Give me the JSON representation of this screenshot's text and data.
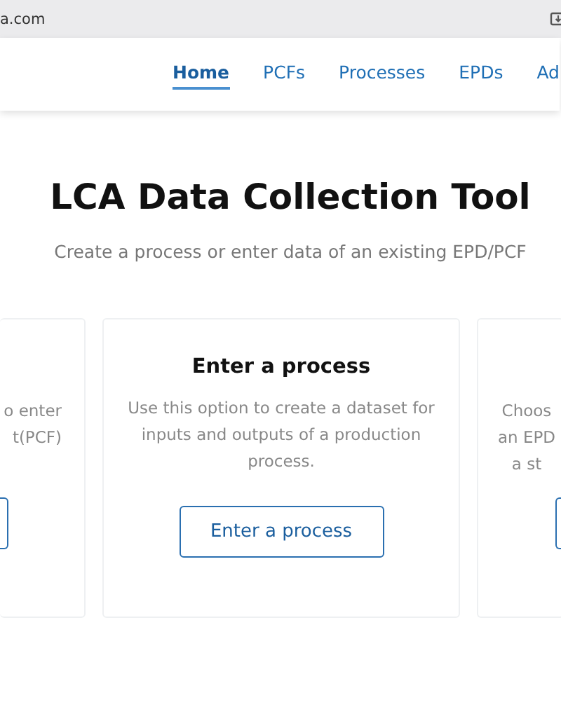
{
  "browser": {
    "url": "a.com"
  },
  "nav": {
    "items": [
      {
        "label": "Home",
        "selected": true
      },
      {
        "label": "PCFs",
        "selected": false
      },
      {
        "label": "Processes",
        "selected": false
      },
      {
        "label": "EPDs",
        "selected": false
      },
      {
        "label": "Ad",
        "selected": false
      }
    ]
  },
  "hero": {
    "title": "LCA Data Collection Tool",
    "subtitle": "Create a process or enter data of an existing EPD/PCF"
  },
  "cards": [
    {
      "kind": "clipped-left",
      "lines": [
        "o enter",
        "t(PCF)"
      ]
    },
    {
      "kind": "full",
      "heading": "Enter a process",
      "description": "Use this option to create a dataset for inputs and outputs of a production process.",
      "button": "Enter a process"
    },
    {
      "kind": "clipped-right",
      "lines": [
        "Choos",
        "an EPD",
        "a st"
      ]
    }
  ]
}
